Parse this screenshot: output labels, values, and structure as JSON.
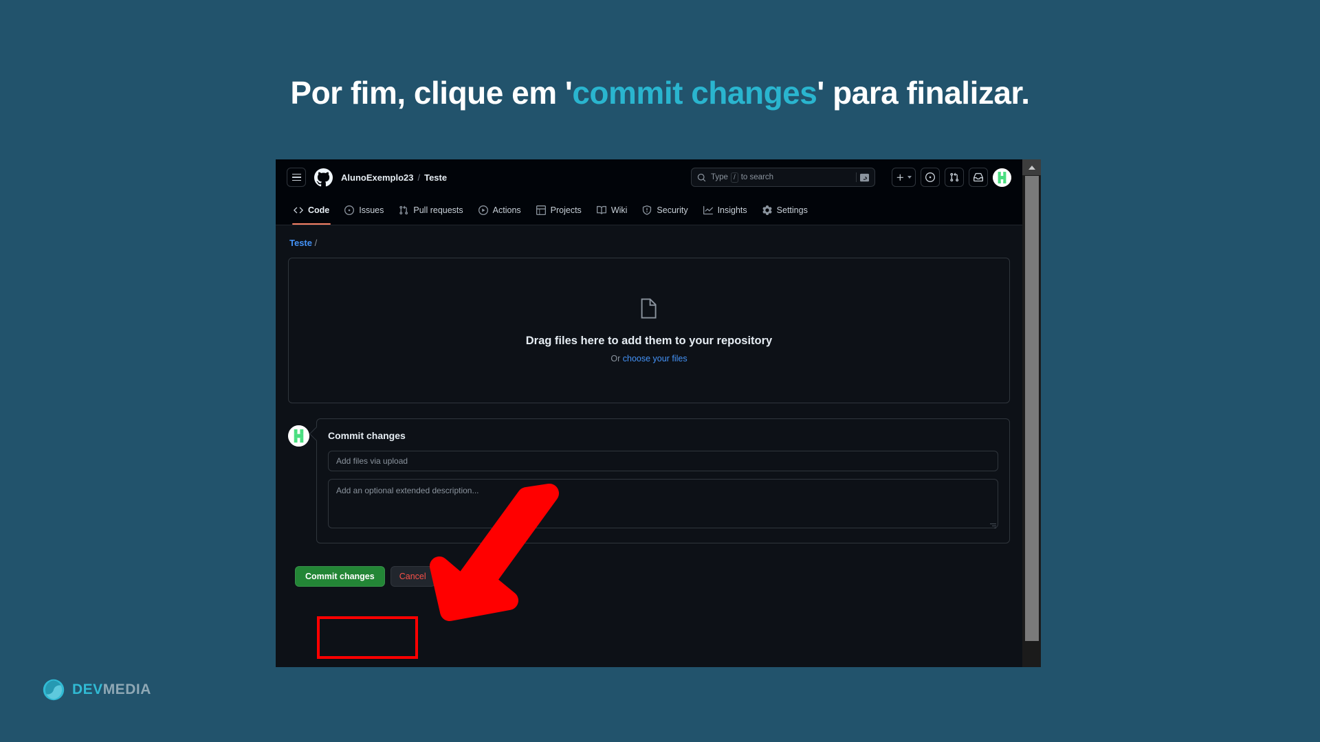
{
  "slide": {
    "title_prefix": "Por fim, clique em '",
    "title_highlight": "commit changes",
    "title_suffix": "' para finalizar."
  },
  "colors": {
    "background": "#22536c",
    "highlight_text": "#2ab5cf",
    "arrow": "#ff0000",
    "highlight_box": "#ff0000",
    "commit_button": "#238636",
    "cancel_text": "#f85149",
    "link": "#4493f8",
    "active_tab_underline": "#f78166"
  },
  "github": {
    "header": {
      "hamburger_icon": "hamburger-menu-icon",
      "logo_icon": "github-mark-icon",
      "owner": "AlunoExemplo23",
      "separator": "/",
      "repo": "Teste",
      "search": {
        "icon": "search-icon",
        "placeholder_before": "Type",
        "placeholder_key": "/",
        "placeholder_after": "to search",
        "terminal_icon": "terminal-icon"
      },
      "actions": [
        {
          "name": "create-new-button",
          "icon": "plus-icon",
          "has_caret": true
        },
        {
          "name": "issues-button",
          "icon": "issue-opened-icon",
          "has_caret": false
        },
        {
          "name": "pull-requests-button",
          "icon": "git-pull-request-icon",
          "has_caret": false
        },
        {
          "name": "inbox-button",
          "icon": "inbox-icon",
          "has_caret": false
        }
      ],
      "avatar": "user-avatar"
    },
    "repo_nav": [
      {
        "label": "Code",
        "icon": "code-icon",
        "active": true
      },
      {
        "label": "Issues",
        "icon": "issue-opened-icon",
        "active": false
      },
      {
        "label": "Pull requests",
        "icon": "git-pull-request-icon",
        "active": false
      },
      {
        "label": "Actions",
        "icon": "play-icon",
        "active": false
      },
      {
        "label": "Projects",
        "icon": "table-icon",
        "active": false
      },
      {
        "label": "Wiki",
        "icon": "book-icon",
        "active": false
      },
      {
        "label": "Security",
        "icon": "shield-icon",
        "active": false
      },
      {
        "label": "Insights",
        "icon": "graph-icon",
        "active": false
      },
      {
        "label": "Settings",
        "icon": "gear-icon",
        "active": false
      }
    ],
    "breadcrumb": {
      "repo": "Teste",
      "slash": "/"
    },
    "dropzone": {
      "file_icon": "file-icon",
      "title": "Drag files here to add them to your repository",
      "or_text": "Or",
      "link_text": "choose your files"
    },
    "commit": {
      "avatar": "user-avatar",
      "heading": "Commit changes",
      "message_placeholder": "Add files via upload",
      "message_value": "",
      "description_placeholder": "Add an optional extended description...",
      "description_value": "",
      "commit_button_label": "Commit changes",
      "cancel_button_label": "Cancel"
    },
    "scrollbar": {
      "up_arrow_icon": "scroll-up-arrow-icon"
    }
  },
  "branding": {
    "logo_icon": "devmedia-logo-icon",
    "name_bold": "DEV",
    "name_light": "MEDIA"
  }
}
